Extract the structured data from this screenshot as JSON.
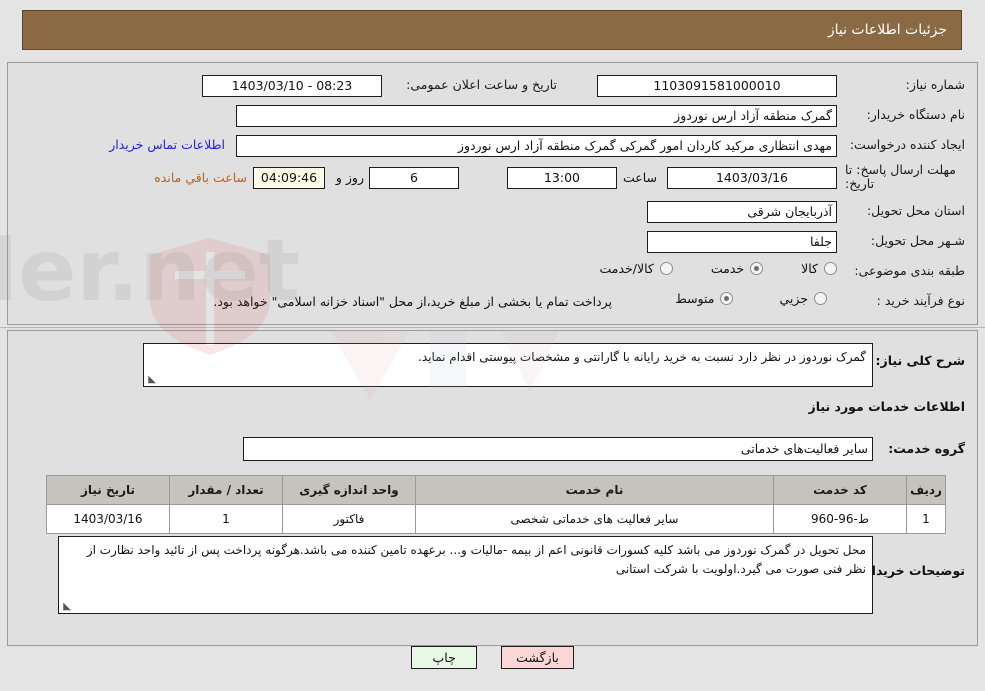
{
  "header": {
    "title": "جزئیات اطلاعات نیاز",
    "bar_color": "#8b6a43"
  },
  "form": {
    "need_number_label": "شماره نیاز:",
    "need_number_value": "1103091581000010",
    "public_announce_label": "تاریخ و ساعت اعلان عمومی:",
    "public_announce_value": "08:23 - 1403/03/10",
    "buyer_org_label": "نام دستگاه خریدار:",
    "buyer_org_value": "گمرک منطقه آزاد ارس نوردوز",
    "requester_label": "ایجاد کننده درخواست:",
    "requester_value": "مهدی انتظاری مرکید کاردان امور گمرکی گمرک منطقه آزاد ارس نوردوز",
    "contact_link": "اطلاعات تماس خریدار",
    "deadline_label": "مهلت ارسال پاسخ: تا تاریخ:",
    "deadline_date": "1403/03/16",
    "hour_label": "ساعت",
    "deadline_time": "13:00",
    "days_value": "6",
    "days_label": "روز و",
    "countdown_value": "04:09:46",
    "countdown_label": "ساعت باقي مانده",
    "province_label": "استان محل تحویل:",
    "province_value": "آذربایجان شرقی",
    "city_label": "شـهر محل تحویل:",
    "city_value": "جلفا",
    "category_label": "طبقه بندی موضوعی:",
    "category_options": [
      {
        "label": "کالا",
        "selected": false
      },
      {
        "label": "خدمت",
        "selected": true
      },
      {
        "label": "کالا/خدمت",
        "selected": false
      }
    ],
    "process_label": "نوع فرآیند خرید :",
    "process_options": [
      {
        "label": "جزیي",
        "selected": false
      },
      {
        "label": "متوسط",
        "selected": true
      }
    ],
    "treasury_note": "پرداخت تمام یا بخشی از مبلغ خرید،از محل \"اسناد خزانه اسلامی\" خواهد بود."
  },
  "details": {
    "general_desc_label": "شرح کلی نیاز:",
    "general_desc_value": "گمرک نوردوز در نظر دارد نسبت به خرید رایانه با گارانتی و مشخصات پیوستی اقدام نماید.",
    "services_section_title": "اطلاعات خدمات مورد نیاز",
    "service_group_label": "گروه خدمت:",
    "service_group_value": "سایر فعالیت‌های خدماتی",
    "buyer_notes_label": "توضیحات خریدار:",
    "buyer_notes_value": "محل تحویل در گمرک نوردوز می باشد کلیه کسورات قانونی اعم از بیمه -مالیات و... برعهده تامین کننده می باشد.هرگونه پرداخت پس از تائید واحد نظارت از نظر فنی صورت می گیرد.اولویت با شرکت استانی"
  },
  "table": {
    "headers": [
      "ردیف",
      "کد خدمت",
      "نام خدمت",
      "واحد اندازه گیری",
      "تعداد / مقدار",
      "تاریخ نیاز"
    ],
    "rows": [
      [
        "1",
        "ط-96-960",
        "سایر فعالیت های خدماتی شخصی",
        "فاکتور",
        "1",
        "1403/03/16"
      ]
    ]
  },
  "buttons": {
    "print": "چاپ",
    "back": "بازگشت"
  }
}
